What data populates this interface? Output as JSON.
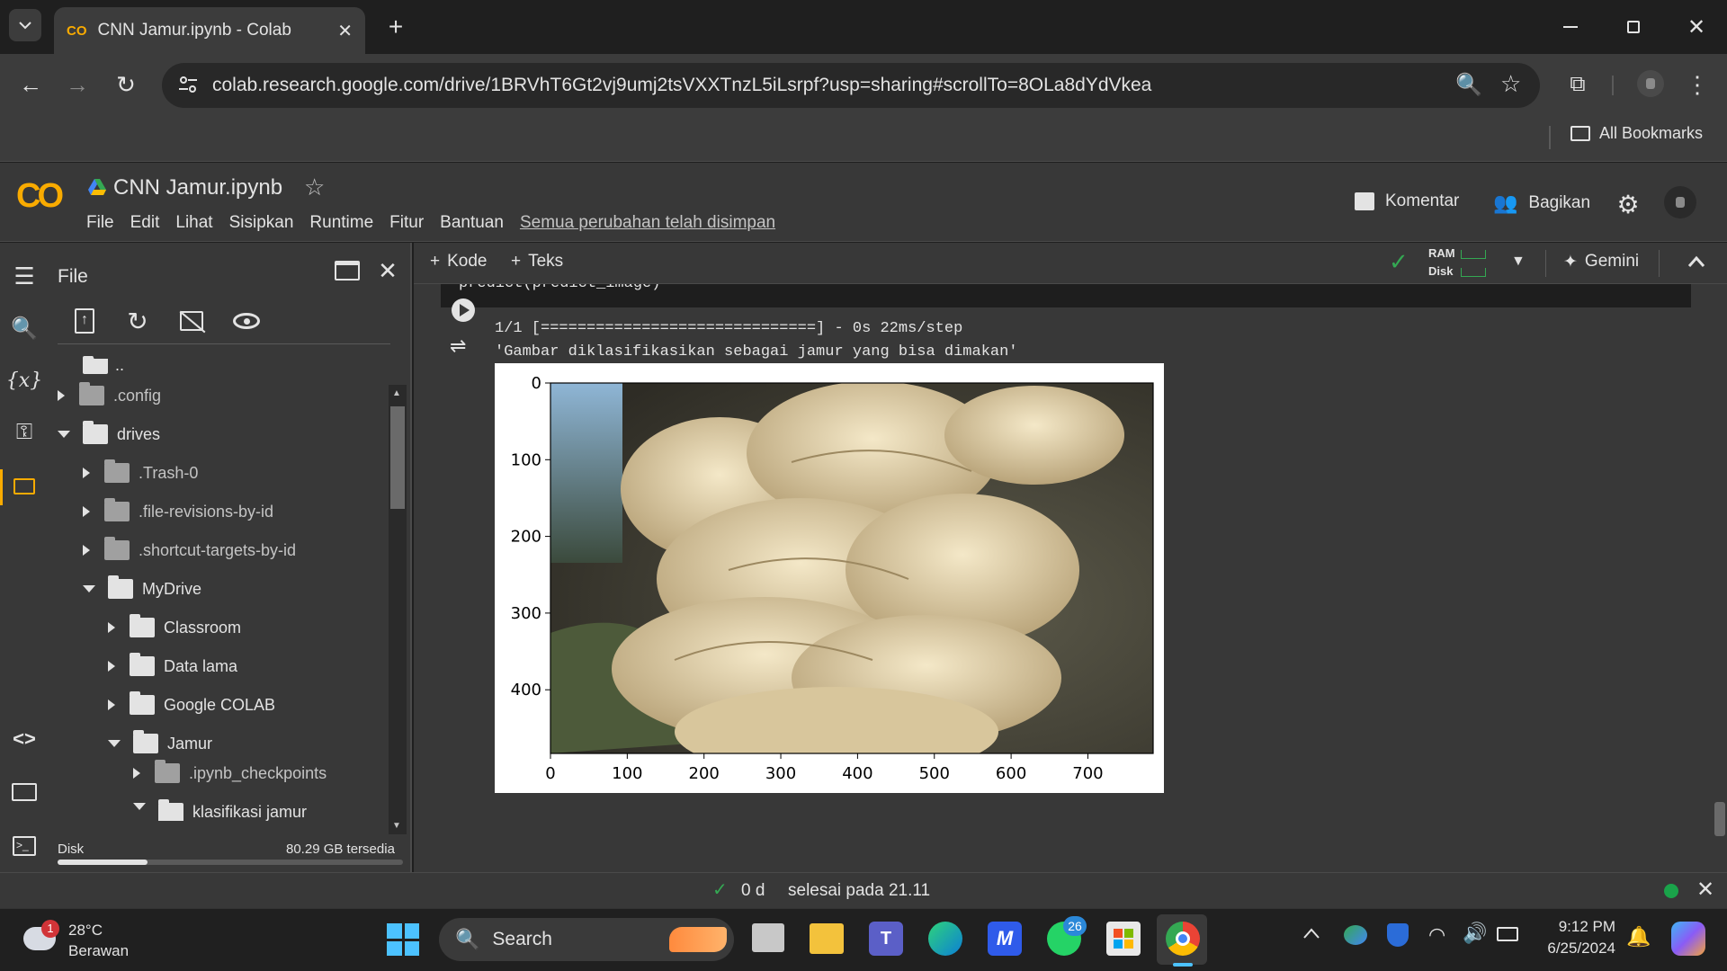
{
  "browser": {
    "tab_title": "CNN Jamur.ipynb - Colab",
    "url": "colab.research.google.com/drive/1BRVhT6Gt2vj9umj2tsVXXTnzL5iLsrpf?usp=sharing#scrollTo=8OLa8dYdVkea",
    "all_bookmarks": "All Bookmarks"
  },
  "colab": {
    "logo": "CO",
    "notebook_title": "CNN Jamur.ipynb",
    "menu": [
      "File",
      "Edit",
      "Lihat",
      "Sisipkan",
      "Runtime",
      "Fitur",
      "Bantuan"
    ],
    "saved_status": "Semua perubahan telah disimpan",
    "comment_label": "Komentar",
    "share_label": "Bagikan"
  },
  "sidebar": {
    "title": "File",
    "parent_dir": "..",
    "tree": [
      {
        "name": ".config",
        "level": 0,
        "state": "collapsed",
        "dim": true
      },
      {
        "name": "drives",
        "level": 0,
        "state": "expanded",
        "dim": false
      },
      {
        "name": ".Trash-0",
        "level": 1,
        "state": "collapsed",
        "dim": true
      },
      {
        "name": ".file-revisions-by-id",
        "level": 1,
        "state": "collapsed",
        "dim": true
      },
      {
        "name": ".shortcut-targets-by-id",
        "level": 1,
        "state": "collapsed",
        "dim": true
      },
      {
        "name": "MyDrive",
        "level": 1,
        "state": "expanded",
        "dim": false
      },
      {
        "name": "Classroom",
        "level": 2,
        "state": "collapsed",
        "dim": false
      },
      {
        "name": "Data lama",
        "level": 2,
        "state": "collapsed",
        "dim": false
      },
      {
        "name": "Google COLAB",
        "level": 2,
        "state": "collapsed",
        "dim": false
      },
      {
        "name": "Jamur",
        "level": 2,
        "state": "expanded",
        "dim": false
      },
      {
        "name": ".ipynb_checkpoints",
        "level": 3,
        "state": "collapsed",
        "dim": true
      },
      {
        "name": "klasifikasi jamur",
        "level": 3,
        "state": "expanded",
        "dim": false
      }
    ],
    "disk_label": "Disk",
    "disk_free": "80.29 GB tersedia",
    "disk_used_fraction": 0.26
  },
  "notebook_toolbar": {
    "add_code": "Kode",
    "add_text": "Teks",
    "ram_label": "RAM",
    "disk_label": "Disk",
    "gemini_label": "Gemini"
  },
  "cell": {
    "code_line": "predict(predict_image)",
    "progress_line": "1/1 [==============================] - 0s 22ms/step",
    "result_line": "'Gambar diklasifikasikan sebagai jamur yang bisa dimakan'",
    "plot": {
      "y_ticks": [
        "0",
        "100",
        "200",
        "300",
        "400"
      ],
      "x_ticks": [
        "0",
        "100",
        "200",
        "300",
        "400",
        "500",
        "600",
        "700"
      ]
    }
  },
  "statusbar": {
    "duration": "0 d",
    "finished_text": "selesai pada 21.11"
  },
  "taskbar": {
    "weather_temp": "28°C",
    "weather_desc": "Berawan",
    "weather_badge": "1",
    "search_placeholder": "Search",
    "whatsapp_badge": "26",
    "time": "9:12 PM",
    "date": "6/25/2024"
  }
}
